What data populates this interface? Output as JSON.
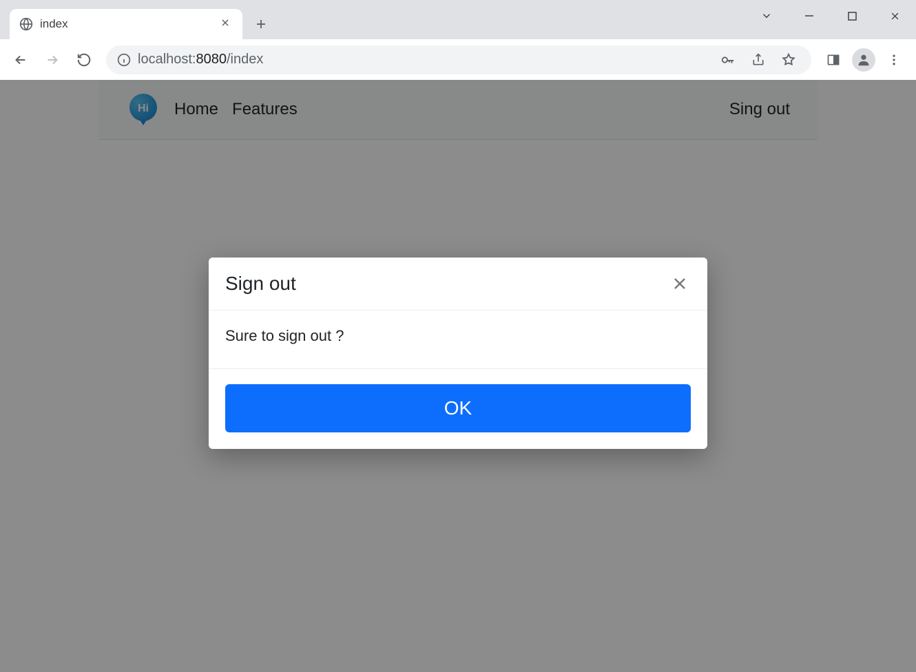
{
  "browser": {
    "tab_title": "index",
    "url_host": "localhost:",
    "url_port": "8080",
    "url_path": "/index"
  },
  "navbar": {
    "logo_text": "Hi",
    "home": "Home",
    "features": "Features",
    "sign_out": "Sing out"
  },
  "dialog": {
    "title": "Sign out",
    "body": "Sure to sign out ?",
    "ok": "OK"
  }
}
